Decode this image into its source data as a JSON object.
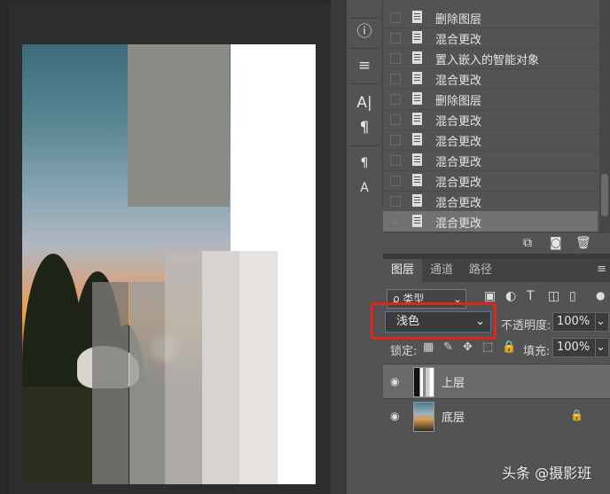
{
  "toolstrip": {
    "tools": [
      {
        "icon": "info-icon",
        "glyph": "ⓘ"
      },
      {
        "icon": "properties-icon",
        "glyph": "≡"
      },
      {
        "icon": "character-icon",
        "glyph": "A|"
      },
      {
        "icon": "paragraph-icon",
        "glyph": "¶"
      },
      {
        "icon": "paragraph-styles-icon",
        "glyph": "¶"
      },
      {
        "icon": "character-styles-icon",
        "glyph": "A"
      }
    ]
  },
  "history": {
    "items": [
      {
        "label": "删除图层",
        "selected": false
      },
      {
        "label": "混合更改",
        "selected": false
      },
      {
        "label": "置入嵌入的智能对象",
        "selected": false
      },
      {
        "label": "混合更改",
        "selected": false
      },
      {
        "label": "删除图层",
        "selected": false
      },
      {
        "label": "混合更改",
        "selected": false
      },
      {
        "label": "混合更改",
        "selected": false
      },
      {
        "label": "混合更改",
        "selected": false
      },
      {
        "label": "混合更改",
        "selected": false
      },
      {
        "label": "混合更改",
        "selected": false
      },
      {
        "label": "混合更改",
        "selected": true
      }
    ]
  },
  "layers_panel": {
    "tabs": [
      "图层",
      "通道",
      "路径"
    ],
    "filter_label": "ρ 类型",
    "blend_mode": "浅色",
    "opacity_label": "不透明度:",
    "opacity_value": "100%",
    "lock_label": "锁定:",
    "fill_label": "填充:",
    "fill_value": "100%",
    "layers": [
      {
        "name": "上层",
        "selected": true,
        "locked": false
      },
      {
        "name": "底层",
        "selected": false,
        "locked": true
      }
    ]
  },
  "watermark": "头条 @摄影班",
  "colors": {
    "panel_bg": "#535353",
    "canvas_bg": "#282828",
    "highlight_border": "#e0261d",
    "selected_row": "#727272"
  }
}
